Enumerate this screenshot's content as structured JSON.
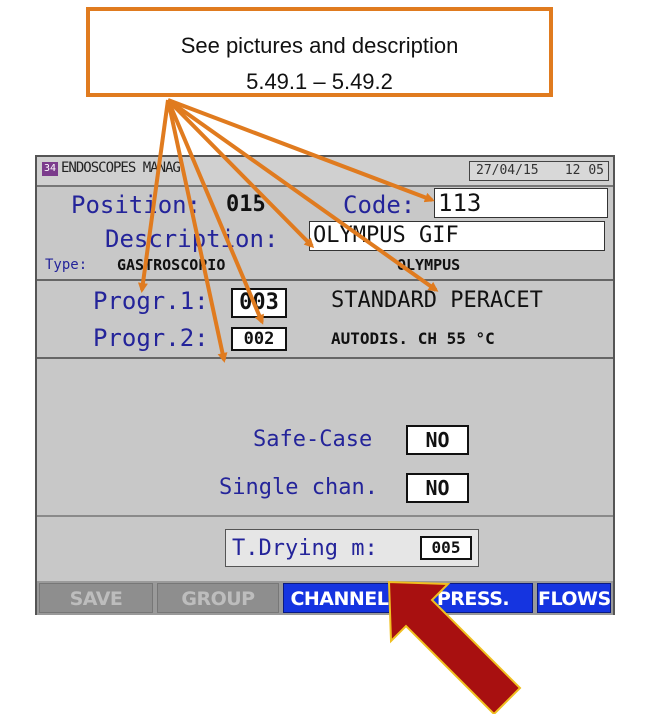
{
  "callout": {
    "line1": "See pictures and description",
    "line2": "5.49.1 – 5.49.2"
  },
  "header": {
    "id_badge": "34",
    "title": "ENDOSCOPES MANAG.",
    "date": "27/04/15",
    "time": "12 05"
  },
  "endoscope": {
    "position_label": "Position:",
    "position_value": "015",
    "code_label": "Code:",
    "code_value": "113",
    "description_label": "Description:",
    "description_value": "OLYMPUS GIF",
    "type_label": "Type:",
    "type_value": "GASTROSCOPIO",
    "brand_value": "OLYMPUS"
  },
  "programs": {
    "progr1_label": "Progr.1:",
    "progr1_value": "003",
    "progr1_name": "STANDARD PERACET",
    "progr2_label": "Progr.2:",
    "progr2_value": "002",
    "progr2_name": "AUTODIS. CH 55 °C"
  },
  "options": {
    "safe_case_label": "Safe-Case",
    "safe_case_value": "NO",
    "single_chan_label": "Single chan.",
    "single_chan_value": "NO",
    "drying_label": "T.Drying m:",
    "drying_value": "005"
  },
  "buttons": {
    "save": "SAVE",
    "group": "GROUP",
    "channels": "CHANNELS",
    "press": "PRESS.",
    "flows": "FLOWS"
  },
  "colors": {
    "annotation_arrow": "#e07b1f",
    "pointer_arrow": "#b01010",
    "active_button": "#1534e0",
    "label_text": "#24249a"
  }
}
